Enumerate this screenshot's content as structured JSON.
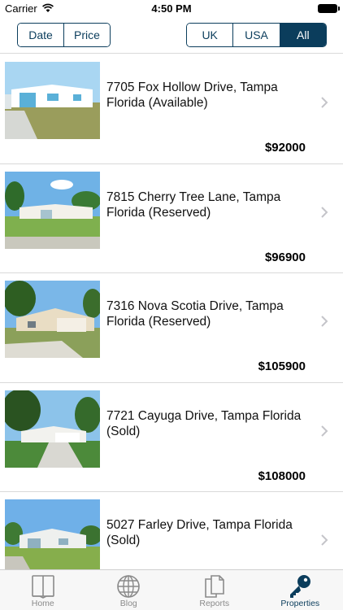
{
  "status_bar": {
    "carrier": "Carrier",
    "time": "4:50 PM"
  },
  "filters": {
    "sort": [
      "Date",
      "Price"
    ],
    "region": [
      "UK",
      "USA",
      "All"
    ],
    "region_selected": "All"
  },
  "properties": [
    {
      "title": "7705 Fox Hollow Drive, Tampa Florida (Available)",
      "price": "$92000"
    },
    {
      "title": "7815 Cherry Tree Lane, Tampa Florida (Reserved)",
      "price": "$96900"
    },
    {
      "title": "7316 Nova Scotia Drive, Tampa Florida (Reserved)",
      "price": "$105900"
    },
    {
      "title": "7721 Cayuga Drive, Tampa Florida (Sold)",
      "price": "$108000"
    },
    {
      "title": "5027 Farley Drive, Tampa Florida (Sold)",
      "price": ""
    }
  ],
  "tabs": [
    {
      "label": "Home",
      "icon": "book-icon"
    },
    {
      "label": "Blog",
      "icon": "globe-icon"
    },
    {
      "label": "Reports",
      "icon": "documents-icon"
    },
    {
      "label": "Properties",
      "icon": "key-icon"
    }
  ],
  "colors": {
    "accent": "#0b3d5c",
    "tab_inactive": "#8a8a8a"
  }
}
